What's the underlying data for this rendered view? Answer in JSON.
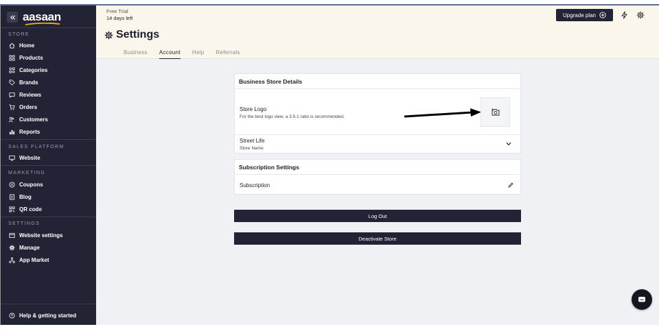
{
  "brand": {
    "name": "aasaan",
    "underline_color": "#f5b400"
  },
  "sidebar": {
    "sections": {
      "store": "STORE",
      "sales_platform": "SALES PLATFORM",
      "marketing": "MARKETING",
      "settings": "SETTINGS"
    },
    "items": {
      "home": "Home",
      "products": "Products",
      "categories": "Categories",
      "brands": "Brands",
      "reviews": "Reviews",
      "orders": "Orders",
      "customers": "Customers",
      "reports": "Reports",
      "website": "Website",
      "coupons": "Coupons",
      "blog": "Blog",
      "qr_code": "QR code",
      "website_settings": "Website settings",
      "manage": "Manage",
      "app_market": "App Market"
    },
    "help": "Help & getting started"
  },
  "header": {
    "trial_label": "Free Trial",
    "trial_days": "14 days left",
    "upgrade_label": "Upgrade plan",
    "title": "Settings",
    "tabs": [
      "Business",
      "Account",
      "Help",
      "Referrals"
    ],
    "active_tab": "Account"
  },
  "business_card": {
    "title": "Business Store Details",
    "logo_label": "Store Logo",
    "logo_hint": "For the best logo view, a 3.5:1 ratio is recommended.",
    "store_name_value": "Street Life",
    "store_name_label": "Store Name"
  },
  "subscription_card": {
    "title": "Subscription Settings",
    "row_label": "Subscription"
  },
  "actions": {
    "logout": "Log Out",
    "deactivate": "Deactivate Store"
  },
  "icons": {
    "collapse": "double-chevron-left-icon",
    "camera": "camera-add-icon",
    "chat": "chat-icon",
    "bolt": "bolt-icon",
    "gear": "gear-icon"
  },
  "colors": {
    "sidebar_bg": "#222436",
    "header_bg": "#fbf6ec",
    "main_bg": "#eff1f5",
    "button_dark": "#222436"
  }
}
